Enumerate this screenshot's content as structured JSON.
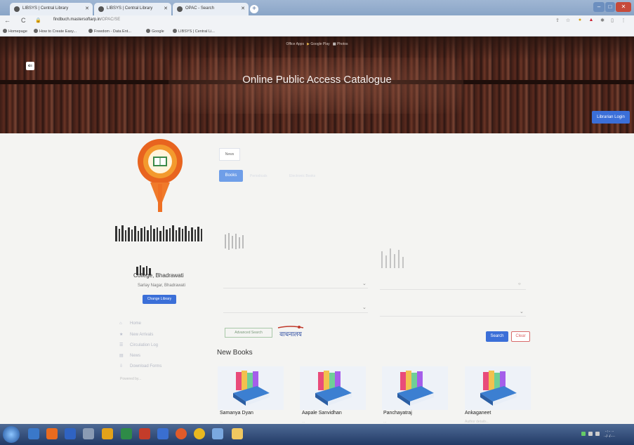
{
  "browser": {
    "tabs": [
      {
        "label": "LIBSYS | Central Library"
      },
      {
        "label": "LIBSYS | Central Library"
      },
      {
        "label": "OPAC - Search"
      }
    ],
    "url_host": "findbuch.mastersoftarp.in",
    "url_path": "/OPAC/SE",
    "bookmarks": [
      {
        "label": "Homepage"
      },
      {
        "label": "How to Create Easy..."
      },
      {
        "label": "Freedom - Data Ent..."
      },
      {
        "label": "Google"
      },
      {
        "label": "LIBSYS | Central Li..."
      }
    ],
    "apps_row": [
      {
        "label": "Office Apps"
      },
      {
        "label": "Google Play"
      },
      {
        "label": "Photos"
      }
    ]
  },
  "banner": {
    "title": "Online Public Access Catalogue",
    "login_label": "Librarian Login"
  },
  "college": {
    "subtitle": "College, Bhadrawati",
    "address": "Sarlay Nagar, Bhadrawati",
    "change_library": "Change Library"
  },
  "sidebar": {
    "items": [
      {
        "label": "Home",
        "icon": "home-icon"
      },
      {
        "label": "New Arrivals",
        "icon": "star-icon"
      },
      {
        "label": "Circulation Log",
        "icon": "list-icon"
      },
      {
        "label": "News",
        "icon": "news-icon"
      },
      {
        "label": "Download Forms",
        "icon": "download-icon"
      }
    ],
    "footer": "Powered by..."
  },
  "main": {
    "news_tab": "News",
    "books_tab": "Books",
    "faint_tabs": [
      "Periodicals",
      "Electronic Books"
    ],
    "advanced_search": "Advanced Search",
    "reader_logo_text": "वाचनालय",
    "search_label": "Search",
    "clear_label": "Clear",
    "new_books_title": "New Books"
  },
  "new_books": [
    {
      "title": "Samanya Dyan",
      "sub": "...",
      "color": "#7aa0d8"
    },
    {
      "title": "Aapale Sanvidhan",
      "sub": "...",
      "color": "#7aa0d8"
    },
    {
      "title": "Panchayatraj",
      "sub": "...",
      "color": "#7aa0d8"
    },
    {
      "title": "Ankaganeet",
      "sub": "Author details...",
      "color": "#7aa0d8"
    }
  ],
  "colors": {
    "primary": "#3b6fd8",
    "books_tab": "#6f9ee8",
    "clear_border": "#d86a6a",
    "banner_dark": "#3a1c15"
  }
}
